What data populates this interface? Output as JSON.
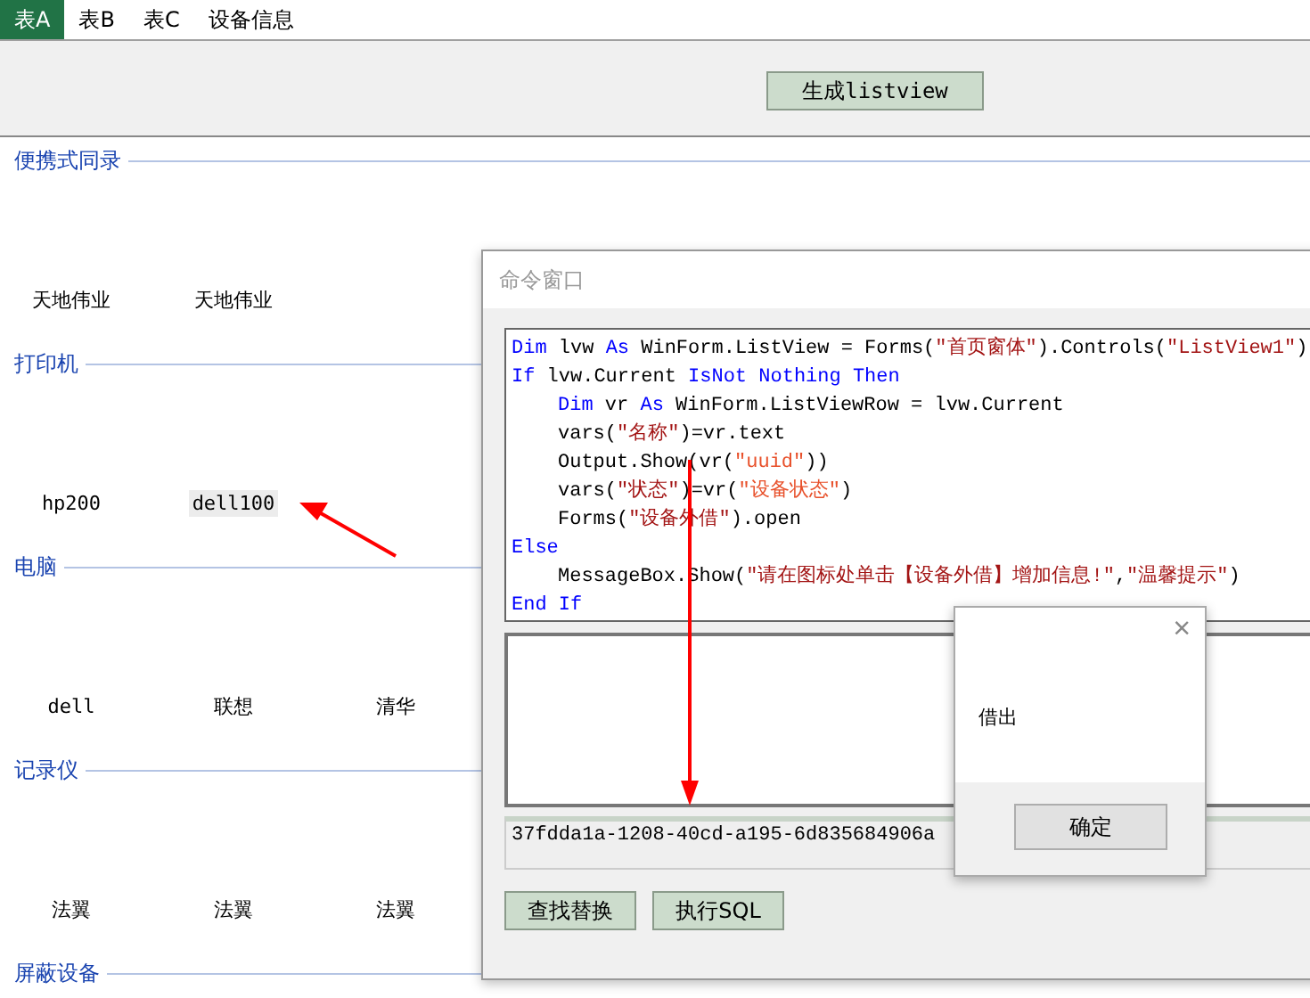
{
  "tabs": [
    {
      "label": "表A",
      "selected": true
    },
    {
      "label": "表B",
      "selected": false
    },
    {
      "label": "表C",
      "selected": false
    },
    {
      "label": "设备信息",
      "selected": false
    }
  ],
  "toolbar": {
    "button": "生成listview"
  },
  "sections": [
    {
      "title": "便携式同录",
      "items": [
        {
          "label": "天地伟业",
          "selected": false
        },
        {
          "label": "天地伟业",
          "selected": false
        }
      ]
    },
    {
      "title": "打印机",
      "items": [
        {
          "label": "hp200",
          "selected": false
        },
        {
          "label": "dell100",
          "selected": true
        }
      ]
    },
    {
      "title": "电脑",
      "items": [
        {
          "label": "dell",
          "selected": false
        },
        {
          "label": "联想",
          "selected": false
        },
        {
          "label": "清华",
          "selected": false
        }
      ]
    },
    {
      "title": "记录仪",
      "items": [
        {
          "label": "法翼",
          "selected": false
        },
        {
          "label": "法翼",
          "selected": false
        },
        {
          "label": "法翼",
          "selected": false
        }
      ]
    },
    {
      "title": "屏蔽设备"
    }
  ],
  "command_window": {
    "title": "命令窗口",
    "code": [
      {
        "tokens": [
          {
            "kind": "keyword",
            "text": "Dim"
          },
          {
            "kind": "plain",
            "text": " lvw "
          },
          {
            "kind": "keyword",
            "text": "As"
          },
          {
            "kind": "plain",
            "text": " WinForm.ListView = Forms("
          },
          {
            "kind": "string",
            "text": "\"首页窗体\""
          },
          {
            "kind": "plain",
            "text": ").Controls("
          },
          {
            "kind": "string",
            "text": "\"ListView1\""
          },
          {
            "kind": "plain",
            "text": ")"
          }
        ]
      },
      {
        "tokens": [
          {
            "kind": "keyword",
            "text": "If"
          },
          {
            "kind": "plain",
            "text": " lvw.Current "
          },
          {
            "kind": "keyword",
            "text": "IsNot Nothing Then"
          }
        ]
      },
      {
        "indent": true,
        "tokens": [
          {
            "kind": "keyword",
            "text": "Dim"
          },
          {
            "kind": "plain",
            "text": " vr "
          },
          {
            "kind": "keyword",
            "text": "As"
          },
          {
            "kind": "plain",
            "text": " WinForm.ListViewRow = lvw.Current"
          }
        ]
      },
      {
        "indent": true,
        "tokens": [
          {
            "kind": "plain",
            "text": "vars("
          },
          {
            "kind": "string",
            "text": "\"名称\""
          },
          {
            "kind": "plain",
            "text": ")=vr.text"
          }
        ]
      },
      {
        "indent": true,
        "tokens": [
          {
            "kind": "plain",
            "text": "Output.Show(vr("
          },
          {
            "kind": "literal",
            "text": "\"uuid\""
          },
          {
            "kind": "plain",
            "text": "))"
          }
        ]
      },
      {
        "indent": true,
        "tokens": [
          {
            "kind": "plain",
            "text": "vars("
          },
          {
            "kind": "string",
            "text": "\"状态\""
          },
          {
            "kind": "plain",
            "text": ")=vr("
          },
          {
            "kind": "literal",
            "text": "\"设备状态\""
          },
          {
            "kind": "plain",
            "text": ")"
          }
        ]
      },
      {
        "indent": true,
        "tokens": [
          {
            "kind": "plain",
            "text": "Forms("
          },
          {
            "kind": "string",
            "text": "\"设备外借\""
          },
          {
            "kind": "plain",
            "text": ").open"
          }
        ]
      },
      {
        "tokens": [
          {
            "kind": "keyword",
            "text": "Else"
          }
        ]
      },
      {
        "indent": true,
        "tokens": [
          {
            "kind": "plain",
            "text": "MessageBox.Show("
          },
          {
            "kind": "string",
            "text": "\"请在图标处单击【设备外借】增加信息!\""
          },
          {
            "kind": "plain",
            "text": ","
          },
          {
            "kind": "string",
            "text": "\"温馨提示\""
          },
          {
            "kind": "plain",
            "text": ")"
          }
        ]
      },
      {
        "tokens": [
          {
            "kind": "keyword",
            "text": "End If"
          }
        ]
      }
    ],
    "result": "37fdda1a-1208-40cd-a195-6d835684906a",
    "buttons": [
      "查找替换",
      "执行SQL"
    ]
  },
  "message_box": {
    "close": "×",
    "message": "借出",
    "button": "确定"
  }
}
